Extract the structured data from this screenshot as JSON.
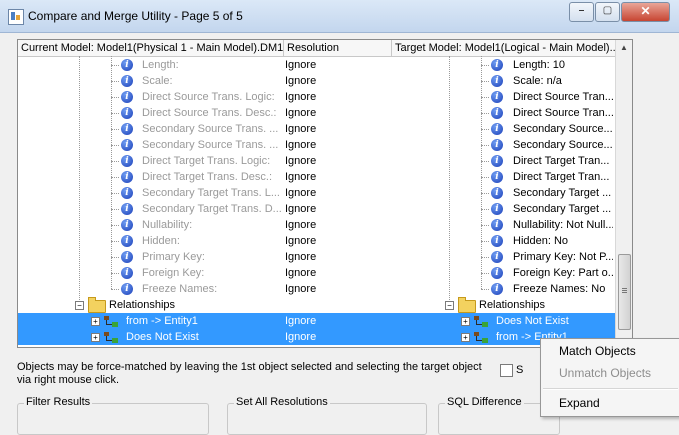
{
  "window": {
    "title": "Compare and Merge Utility  - Page 5 of 5",
    "buttons": {
      "minimize": "⎯",
      "maximize": "▢",
      "close": "✕"
    }
  },
  "columns": {
    "current": "Current Model: Model1(Physical 1 - Main Model).DM1",
    "resolution": "Resolution",
    "target": "Target Model: Model1(Logical - Main Model)..."
  },
  "rows": [
    {
      "left": "Length:",
      "res": "Ignore",
      "right": "Length: 10"
    },
    {
      "left": "Scale:",
      "res": "Ignore",
      "right": "Scale: n/a"
    },
    {
      "left": "Direct Source Trans. Logic:",
      "res": "Ignore",
      "right": "Direct Source Tran..."
    },
    {
      "left": "Direct Source Trans. Desc.:",
      "res": "Ignore",
      "right": "Direct Source Tran..."
    },
    {
      "left": "Secondary Source Trans. ...",
      "res": "Ignore",
      "right": "Secondary Source..."
    },
    {
      "left": "Secondary Source Trans. ...",
      "res": "Ignore",
      "right": "Secondary Source..."
    },
    {
      "left": "Direct Target Trans. Logic:",
      "res": "Ignore",
      "right": "Direct Target Tran..."
    },
    {
      "left": "Direct Target Trans. Desc.:",
      "res": "Ignore",
      "right": "Direct Target Tran..."
    },
    {
      "left": "Secondary Target Trans. L...",
      "res": "Ignore",
      "right": "Secondary Target ..."
    },
    {
      "left": "Secondary Target Trans. D...",
      "res": "Ignore",
      "right": "Secondary Target ..."
    },
    {
      "left": "Nullability:",
      "res": "Ignore",
      "right": "Nullability: Not Null..."
    },
    {
      "left": "Hidden:",
      "res": "Ignore",
      "right": "Hidden: No"
    },
    {
      "left": "Primary Key:",
      "res": "Ignore",
      "right": "Primary Key: Not P..."
    },
    {
      "left": "Foreign Key:",
      "res": "Ignore",
      "right": "Foreign Key: Part o..."
    },
    {
      "left": "Freeze Names:",
      "res": "Ignore",
      "right": "Freeze Names: No"
    }
  ],
  "relationships": {
    "folder_left": "Relationships",
    "folder_right": "Relationships",
    "items": [
      {
        "left": "from -> Entity1",
        "res": "Ignore",
        "right": "Does Not Exist"
      },
      {
        "left": "Does Not Exist",
        "res": "Ignore",
        "right": "from -> Entity1"
      }
    ]
  },
  "note": "Objects may be force-matched by leaving the 1st object selected and selecting the target object via right mouse click.",
  "checkbox_label": "S",
  "groups": {
    "filter": "Filter Results",
    "set_all": "Set All Resolutions",
    "sql": "SQL Difference"
  },
  "context_menu": {
    "match": "Match Objects",
    "unmatch": "Unmatch Objects",
    "expand": "Expand"
  }
}
